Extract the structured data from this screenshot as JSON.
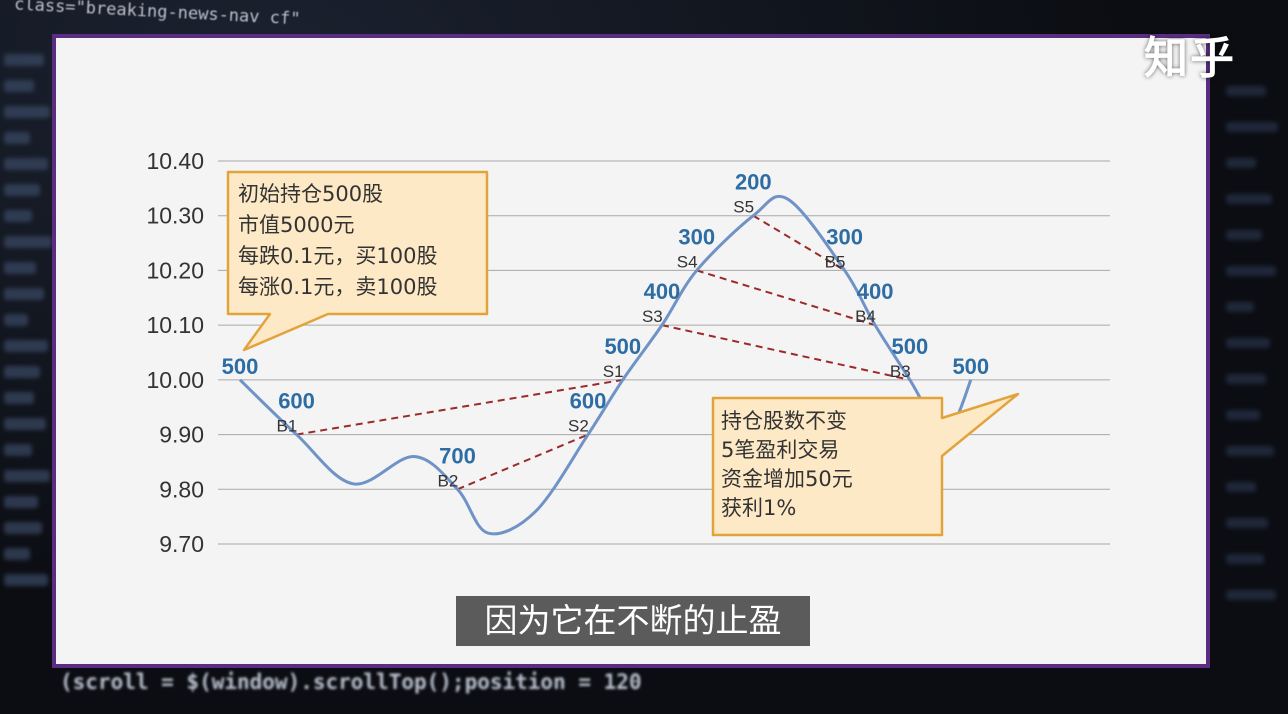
{
  "background": {
    "code_top": "class=\"breaking-news-nav cf\"",
    "code_bottom": "(scroll = $(window).scrollTop();position = 120"
  },
  "logo": "知乎",
  "subtitle": "因为它在不断的止盈",
  "colors": {
    "frame": "#5a2d82",
    "line": "#6f93c7",
    "qty": "#2e6da4",
    "pair": "#9b2a2a",
    "callout_fill": "#fde9c6",
    "callout_border": "#e2a33b"
  },
  "chart_data": {
    "type": "line",
    "y_ticks": [
      "10.40",
      "10.30",
      "10.20",
      "10.10",
      "10.00",
      "9.90",
      "9.80",
      "9.70"
    ],
    "ylim": [
      9.7,
      10.4
    ],
    "xlim": [
      0,
      100
    ],
    "grid": true,
    "series": [
      {
        "values": [
          {
            "x": 0,
            "y": 10.0
          },
          {
            "x": 6.5,
            "y": 9.9
          },
          {
            "x": 13,
            "y": 9.81
          },
          {
            "x": 20,
            "y": 9.86
          },
          {
            "x": 25,
            "y": 9.8
          },
          {
            "x": 28.5,
            "y": 9.72
          },
          {
            "x": 34,
            "y": 9.76
          },
          {
            "x": 40,
            "y": 9.9
          },
          {
            "x": 44,
            "y": 10.0
          },
          {
            "x": 48.5,
            "y": 10.1
          },
          {
            "x": 52.5,
            "y": 10.2
          },
          {
            "x": 59,
            "y": 10.3
          },
          {
            "x": 63,
            "y": 10.33
          },
          {
            "x": 69.5,
            "y": 10.2
          },
          {
            "x": 73,
            "y": 10.1
          },
          {
            "x": 77,
            "y": 10.0
          },
          {
            "x": 80,
            "y": 9.92
          },
          {
            "x": 82,
            "y": 9.92
          },
          {
            "x": 84,
            "y": 10.0
          }
        ]
      }
    ],
    "points": [
      {
        "label": "",
        "qty": "500",
        "x": 0,
        "y": 10.0
      },
      {
        "label": "B1",
        "qty": "600",
        "x": 6.5,
        "y": 9.9
      },
      {
        "label": "B2",
        "qty": "700",
        "x": 25,
        "y": 9.8
      },
      {
        "label": "S2",
        "qty": "600",
        "x": 40,
        "y": 9.9
      },
      {
        "label": "S1",
        "qty": "500",
        "x": 44,
        "y": 10.0
      },
      {
        "label": "S3",
        "qty": "400",
        "x": 48.5,
        "y": 10.1
      },
      {
        "label": "S4",
        "qty": "300",
        "x": 52.5,
        "y": 10.2
      },
      {
        "label": "S5",
        "qty": "200",
        "x": 59,
        "y": 10.3
      },
      {
        "label": "B5",
        "qty": "300",
        "x": 69.5,
        "y": 10.2
      },
      {
        "label": "B4",
        "qty": "400",
        "x": 73,
        "y": 10.1
      },
      {
        "label": "B3",
        "qty": "500",
        "x": 77,
        "y": 10.0
      },
      {
        "label": "",
        "qty": "500",
        "x": 84,
        "y": 10.0
      }
    ],
    "pairs": [
      [
        "B1",
        "S1"
      ],
      [
        "B2",
        "S2"
      ],
      [
        "S3",
        "B3"
      ],
      [
        "S4",
        "B4"
      ],
      [
        "S5",
        "B5"
      ]
    ],
    "annotations": [
      {
        "lines": [
          "初始持仓500股",
          "市值5000元",
          "每跌0.1元，买100股",
          "每涨0.1元，卖100股"
        ]
      },
      {
        "lines": [
          "持仓股数不变",
          "5笔盈利交易",
          "资金增加50元",
          "获利1%"
        ]
      }
    ]
  }
}
